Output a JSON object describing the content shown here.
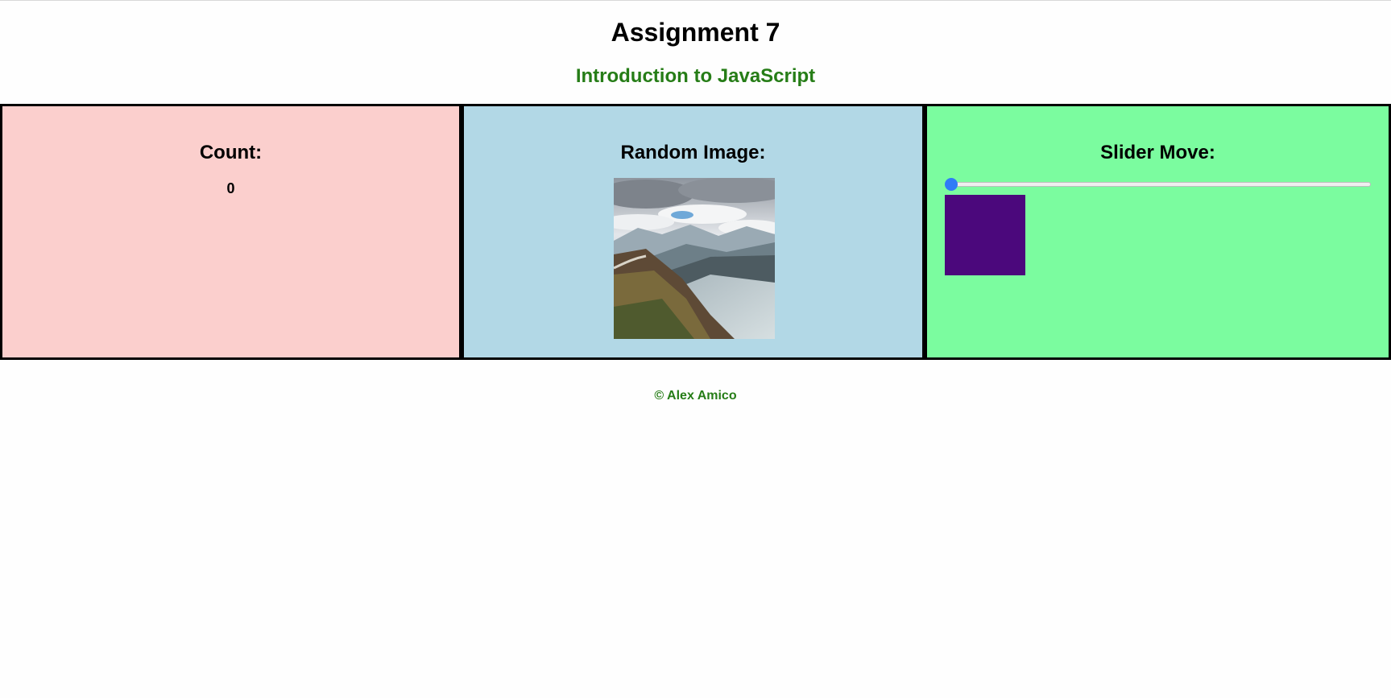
{
  "header": {
    "title": "Assignment 7",
    "subtitle": "Introduction to JavaScript"
  },
  "panels": {
    "count": {
      "heading": "Count:",
      "value": "0",
      "background": "#fbcfcd"
    },
    "random_image": {
      "heading": "Random Image:",
      "image_alt": "mountain landscape with river",
      "background": "#b2d8e6"
    },
    "slider": {
      "heading": "Slider Move:",
      "slider_value": 0,
      "box_color": "#4b087c",
      "thumb_color": "#2f7cf6",
      "background": "#7bfc9f"
    }
  },
  "footer": {
    "text": "© Alex Amico"
  },
  "colors": {
    "accent_green": "#267d17",
    "border": "#000000"
  }
}
